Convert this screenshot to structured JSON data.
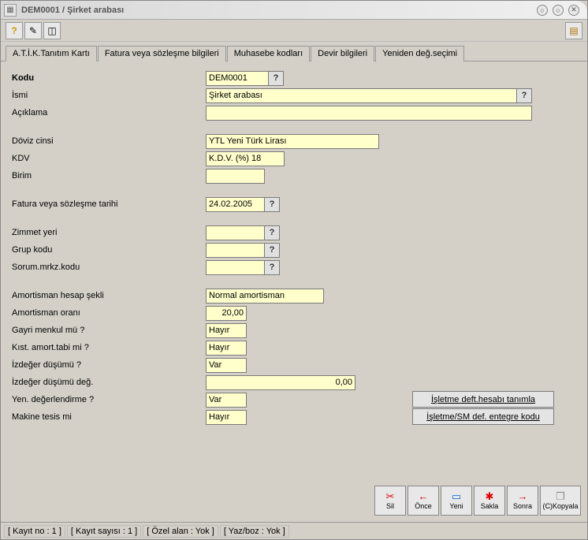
{
  "window": {
    "title": "DEM0001 / Şirket arabası"
  },
  "tabs": [
    "A.T.İ.K.Tanıtım Kartı",
    "Fatura veya sözleşme bilgileri",
    "Muhasebe kodları",
    "Devir bilgileri",
    "Yeniden değ.seçimi"
  ],
  "labels": {
    "kodu": "Kodu",
    "ismi": "İsmi",
    "aciklama": "Açıklama",
    "doviz": "Döviz cinsi",
    "kdv": "KDV",
    "birim": "Birim",
    "faturaTarihi": "Fatura veya sözleşme tarihi",
    "zimmetYeri": "Zimmet yeri",
    "grupKodu": "Grup kodu",
    "sorumMrkz": "Sorum.mrkz.kodu",
    "amortHesap": "Amortisman hesap şekli",
    "amortOrani": "Amortisman oranı",
    "gayriMenkul": "Gayri menkul mü ?",
    "kistAmort": "Kıst. amort.tabi mi ?",
    "izdegerDusumu": "İzdeğer düşümü ?",
    "izdegerDeg": "İzdeğer düşümü değ.",
    "yenDeg": "Yen. değerlendirme ?",
    "makineTesis": "Makine tesis mi"
  },
  "values": {
    "kodu": "DEM0001",
    "ismi": "Şirket arabası",
    "aciklama": "",
    "doviz": "YTL Yeni Türk Lirası",
    "kdv": "K.D.V. (%) 18",
    "birim": "",
    "faturaTarihi": "24.02.2005",
    "zimmetYeri": "",
    "grupKodu": "",
    "sorumMrkz": "",
    "amortHesap": "Normal amortisman",
    "amortOrani": "20,00",
    "gayriMenkul": "Hayır",
    "kistAmort": "Hayır",
    "izdegerDusumu": "Var",
    "izdegerDeg": "0,00",
    "yenDeg": "Var",
    "makineTesis": "Hayır"
  },
  "sideButtons": {
    "isletmeDeft": "İşletme deft.hesabı tanımla",
    "isletmeSM": "İşletme/SM def. entegre kodu"
  },
  "bottomButtons": {
    "sil": "Sil",
    "once": "Önce",
    "yeni": "Yeni",
    "sakla": "Sakla",
    "sonra": "Sonra",
    "kopyala": "(C)Kopyala"
  },
  "status": {
    "kayitNo": "[ Kayıt no : 1 ]",
    "kayitSayisi": "[ Kayıt sayısı : 1 ]",
    "ozelAlan": "[ Özel alan : Yok ]",
    "yazBoz": "[ Yaz/boz : Yok ]"
  }
}
